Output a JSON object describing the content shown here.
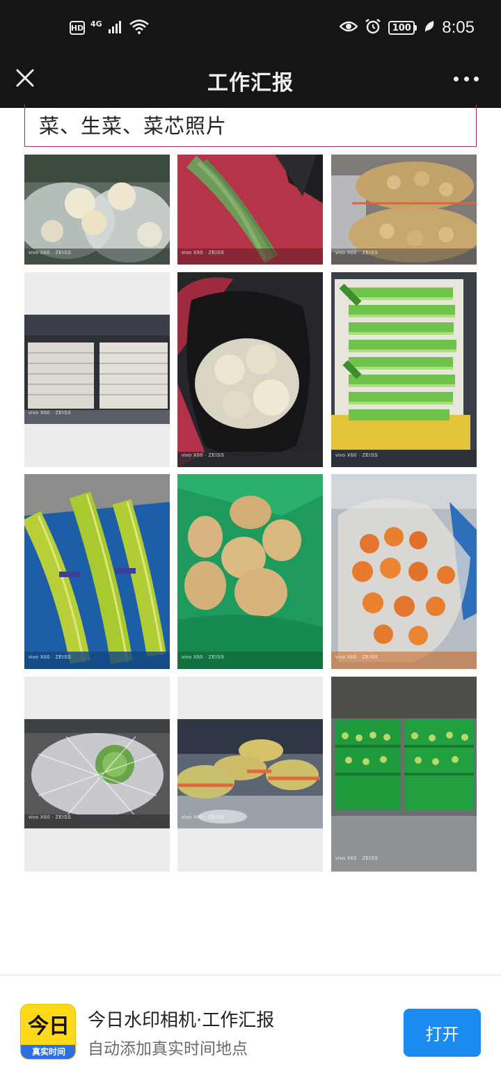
{
  "status_bar": {
    "hd_label": "HD",
    "network_label": "4G",
    "battery_level": "100",
    "time": "8:05"
  },
  "header": {
    "title": "工作汇报",
    "close_icon": "close-icon",
    "more_icon": "more-icon"
  },
  "section": {
    "heading": "菜、生菜、菜芯照片"
  },
  "photos": [
    {
      "subject": "cauliflower",
      "watermark": "vivo X60 · ZEISS"
    },
    {
      "subject": "long-beans",
      "watermark": "vivo X60 · ZEISS"
    },
    {
      "subject": "potatoes-in-mesh-bag",
      "watermark": "vivo X60 · ZEISS"
    },
    {
      "subject": "tofu-trays",
      "watermark": "vivo X60 · ZEISS"
    },
    {
      "subject": "cauliflower-in-black-bag",
      "watermark": "vivo X60 · ZEISS"
    },
    {
      "subject": "celery",
      "watermark": "vivo X60 · ZEISS"
    },
    {
      "subject": "garlic-sprouts",
      "watermark": "vivo X60 · ZEISS"
    },
    {
      "subject": "potatoes-in-green-bag",
      "watermark": "vivo X60 · ZEISS"
    },
    {
      "subject": "carrots",
      "watermark": "vivo X60 · ZEISS"
    },
    {
      "subject": "cabbage-in-net",
      "watermark": "vivo X60 · ZEISS"
    },
    {
      "subject": "wrapped-vegetable-bundles",
      "watermark": "vivo X60 · ZEISS"
    },
    {
      "subject": "green-vegetables-in-crates",
      "watermark": "vivo X60 · ZEISS"
    }
  ],
  "promo": {
    "app_icon_top": "今日",
    "app_icon_bottom": "真实时间",
    "title": "今日水印相机·工作汇报",
    "subtitle": "自动添加真实时间地点",
    "open_label": "打开"
  },
  "colors": {
    "header_bg": "#151515",
    "section_border": "#a4346a",
    "open_button": "#1a8cf0",
    "app_icon_bg": "#ffd81a"
  }
}
